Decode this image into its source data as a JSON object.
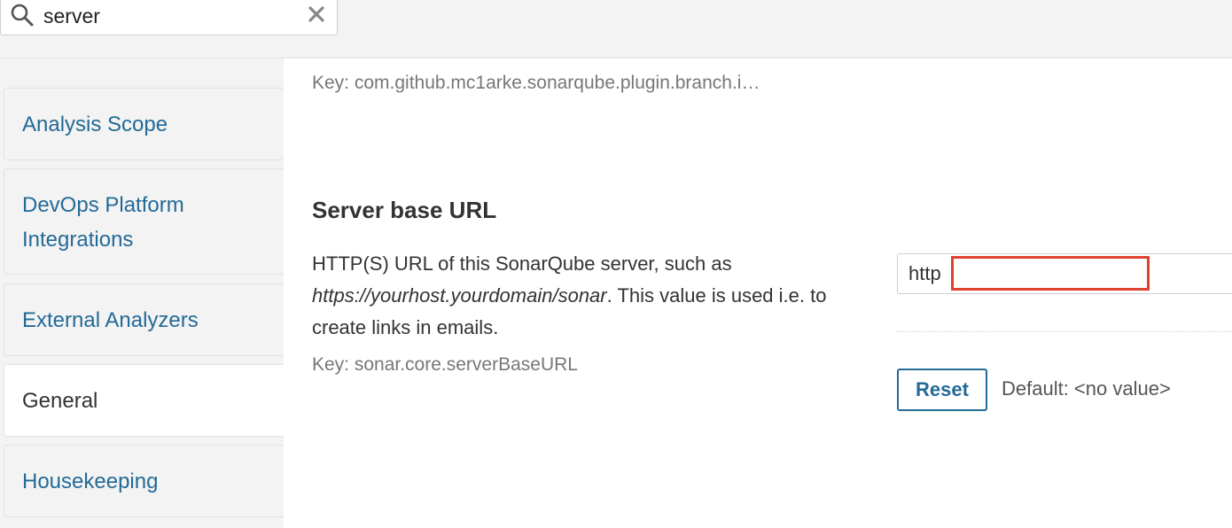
{
  "search": {
    "value": "server"
  },
  "sidebar": {
    "items": [
      {
        "label": "Analysis Scope"
      },
      {
        "label": "DevOps Platform Integrations",
        "line1": "DevOps Platform",
        "line2": "Integrations"
      },
      {
        "label": "External Analyzers"
      },
      {
        "label": "General",
        "active": true
      },
      {
        "label": "Housekeeping"
      }
    ]
  },
  "main": {
    "prev_key": "Key: com.github.mc1arke.sonarqube.plugin.branch.i…",
    "setting": {
      "title": "Server base URL",
      "desc_part1": "HTTP(S) URL of this SonarQube server, such as ",
      "desc_em": "https://yourhost.yourdomain/sonar",
      "desc_part2": ". This value is used i.e. to create links in emails.",
      "key": "Key: sonar.core.serverBaseURL",
      "input_value": "http",
      "reset_label": "Reset",
      "default_text": "Default: <no value>"
    }
  },
  "colors": {
    "link": "#236a97",
    "redaction_border": "#e0412e",
    "background": "#f3f3f3",
    "panel": "#ffffff"
  },
  "icons": {
    "search": "search-icon",
    "clear": "close-icon"
  }
}
